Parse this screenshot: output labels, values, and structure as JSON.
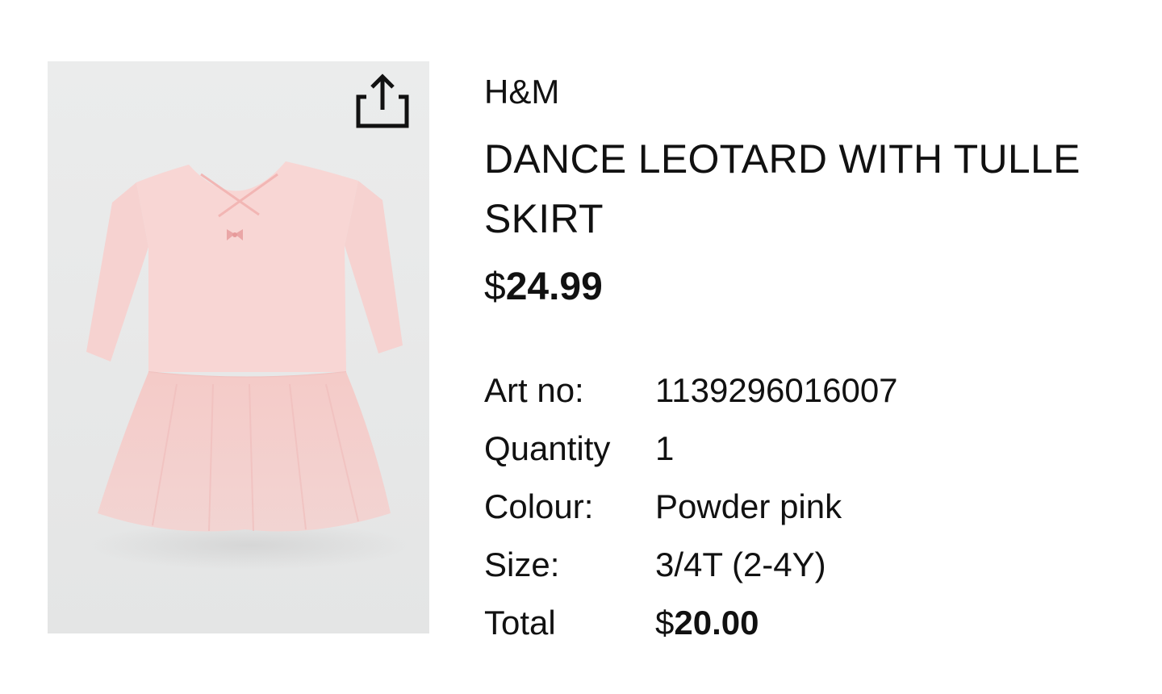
{
  "product": {
    "brand": "H&M",
    "title": "DANCE LEOTARD WITH TULLE SKIRT",
    "price_currency": "$",
    "price_amount": "24.99",
    "image_background": "#e9eaea",
    "garment_color": "#f6cfcf"
  },
  "actions": {
    "share_icon": "share-icon"
  },
  "specs": {
    "art_no_label": "Art no:",
    "art_no_value": "1139296016007",
    "quantity_label": "Quantity",
    "quantity_value": "1",
    "colour_label": "Colour:",
    "colour_value": "Powder pink",
    "size_label": "Size:",
    "size_value": "3/4T (2-4Y)",
    "total_label": "Total",
    "total_currency": "$",
    "total_amount": "20.00"
  }
}
